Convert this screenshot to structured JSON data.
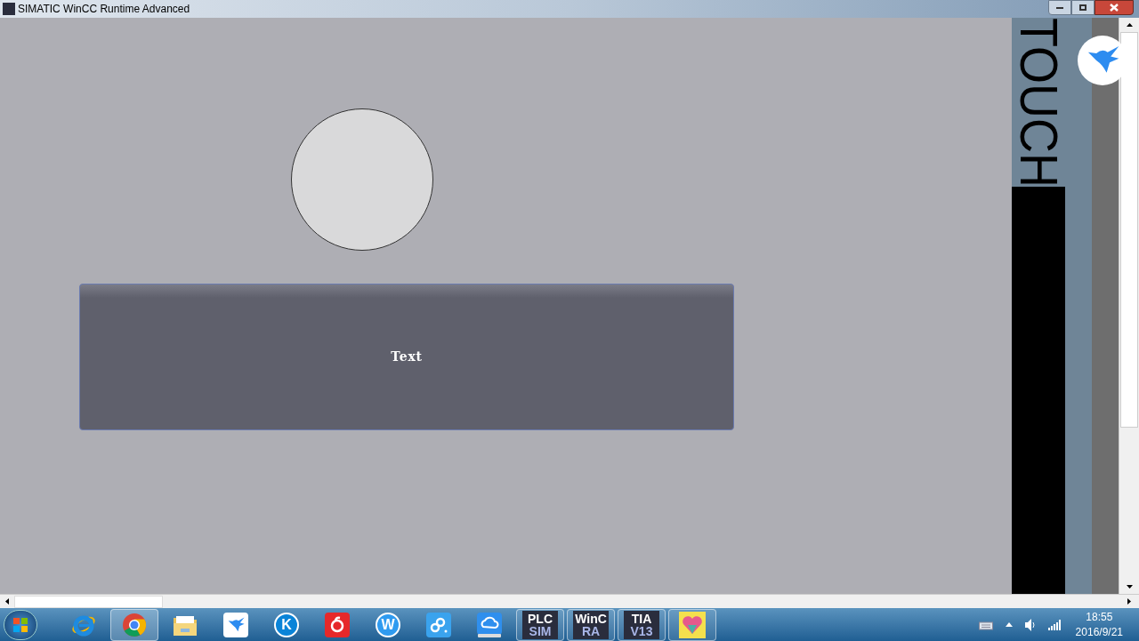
{
  "window": {
    "title": "SIMATIC WinCC Runtime Advanced"
  },
  "screen": {
    "button": {
      "label": "Text"
    },
    "side_banner": {
      "label": "TOUCH"
    }
  },
  "taskbar": {
    "items": [
      {
        "kind": "browser",
        "running": false,
        "selected": false
      },
      {
        "kind": "chrome",
        "running": true,
        "selected": true
      },
      {
        "kind": "folder",
        "running": false,
        "selected": false
      },
      {
        "kind": "bird",
        "running": false,
        "selected": false
      },
      {
        "kind": "letter",
        "glyph": "K",
        "color": "#0a84d8",
        "running": false,
        "selected": false
      },
      {
        "kind": "netease",
        "running": false,
        "selected": false
      },
      {
        "kind": "letter",
        "glyph": "W",
        "color": "#2f9bf0",
        "running": false,
        "selected": false
      },
      {
        "kind": "link",
        "running": false,
        "selected": false
      },
      {
        "kind": "cloud",
        "running": false,
        "selected": false
      },
      {
        "kind": "tile",
        "top": "PLC",
        "bottom": "SIM",
        "running": true,
        "selected": false
      },
      {
        "kind": "tile",
        "top": "WinC",
        "bottom": "RA",
        "running": true,
        "selected": false
      },
      {
        "kind": "tile",
        "top": "TIA",
        "bottom": "V13",
        "running": true,
        "selected": false
      },
      {
        "kind": "heart",
        "running": true,
        "selected": false
      }
    ],
    "clock": {
      "time": "18:55",
      "date": "2016/9/21"
    }
  }
}
